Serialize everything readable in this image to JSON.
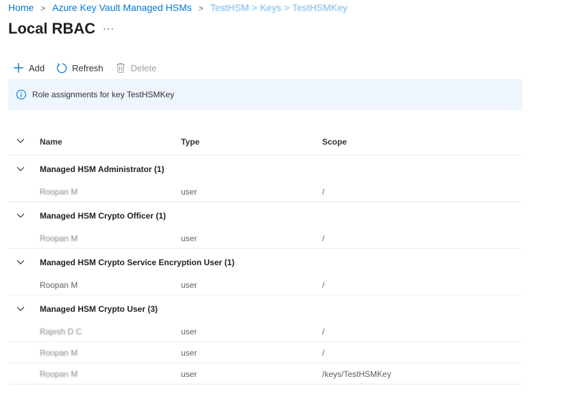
{
  "breadcrumb": {
    "home": "Home",
    "managed_hsms": "Azure Key Vault Managed HSMs",
    "current_obscured": "TestHSM > Keys > TestHSMKey"
  },
  "page": {
    "title": "Local RBAC",
    "more": "···"
  },
  "toolbar": {
    "add": "Add",
    "refresh": "Refresh",
    "delete": "Delete"
  },
  "info": {
    "text": "Role assignments for key TestHSMKey"
  },
  "table": {
    "headers": {
      "name": "Name",
      "type": "Type",
      "scope": "Scope"
    },
    "groups": [
      {
        "label": "Managed HSM Administrator (1)",
        "rows": [
          {
            "name": "Roopan M",
            "type": "user",
            "scope": "/"
          }
        ]
      },
      {
        "label": "Managed HSM Crypto Officer (1)",
        "rows": [
          {
            "name": "Roopan M",
            "type": "user",
            "scope": "/"
          }
        ]
      },
      {
        "label": "Managed HSM Crypto Service Encryption User (1)",
        "rows": [
          {
            "name": "Roopan M",
            "type": "user",
            "scope": "/"
          }
        ]
      },
      {
        "label": "Managed HSM Crypto User (3)",
        "rows": [
          {
            "name": "Rajesh D C",
            "type": "user",
            "scope": "/"
          },
          {
            "name": "Roopan M",
            "type": "user",
            "scope": "/"
          },
          {
            "name": "Roopan M",
            "type": "user",
            "scope": "/keys/TestHSMKey"
          }
        ]
      }
    ]
  },
  "colors": {
    "accent": "#0078d4",
    "info_bg": "#eef5fc",
    "text": "#323130"
  }
}
